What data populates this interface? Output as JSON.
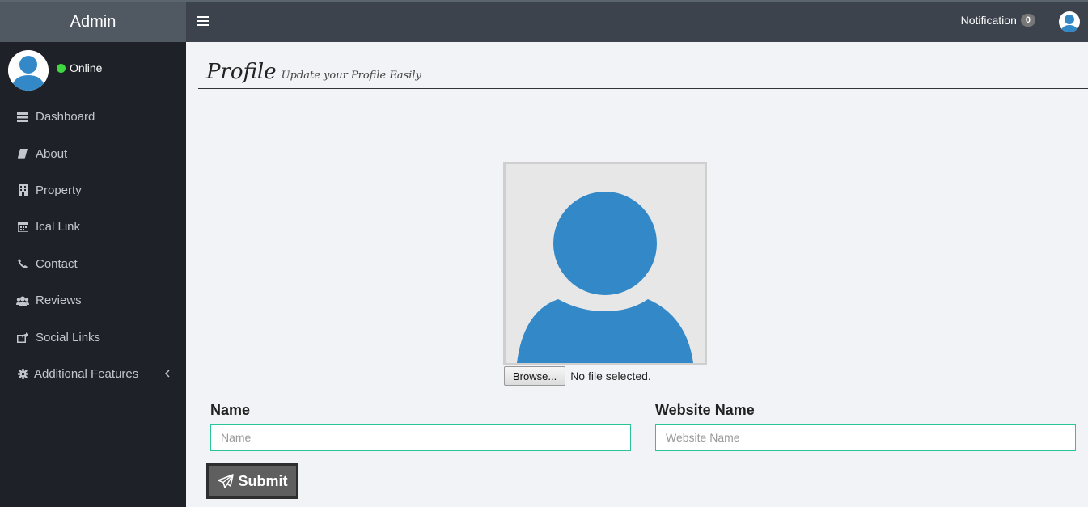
{
  "topbar": {
    "brand": "Admin",
    "menu_toggle_icon": "hamburger-icon",
    "notification_label": "Notification",
    "notification_count": "0",
    "user_icon": "user-avatar-icon"
  },
  "sidebar": {
    "status": "Online",
    "status_color": "#3fd63f",
    "items": [
      {
        "label": "Dashboard",
        "icon": "list-icon"
      },
      {
        "label": "About",
        "icon": "book-icon"
      },
      {
        "label": "Property",
        "icon": "building-icon"
      },
      {
        "label": "Ical Link",
        "icon": "calendar-icon"
      },
      {
        "label": "Contact",
        "icon": "phone-icon"
      },
      {
        "label": "Reviews",
        "icon": "users-icon"
      },
      {
        "label": "Social Links",
        "icon": "share-icon"
      },
      {
        "label": "Additional Features",
        "icon": "gear-icon"
      }
    ]
  },
  "header": {
    "title": "Profile",
    "subtitle": "Update your Profile Easily"
  },
  "photo": {
    "browse_label": "Browse...",
    "file_status": "No file selected."
  },
  "form": {
    "name_label": "Name",
    "name_placeholder": "Name",
    "website_label": "Website Name",
    "website_placeholder": "Website Name",
    "submit_label": "Submit"
  },
  "colors": {
    "accent": "#3388c8",
    "input_border": "#2bc39a",
    "sidebar_bg": "#1e2228",
    "topbar_bg": "#3c434d"
  }
}
